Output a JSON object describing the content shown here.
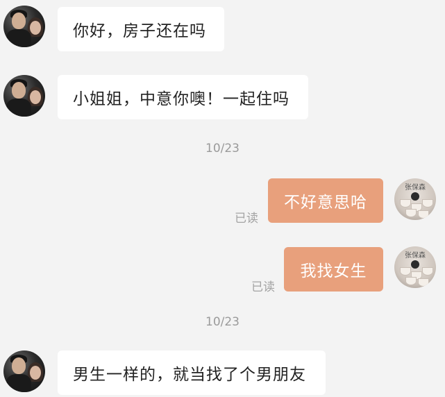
{
  "messages": [
    {
      "text": "你好，房子还在吗"
    },
    {
      "text": "小姐姐，中意你噢！一起住吗"
    },
    {
      "text": "不好意思哈",
      "status": "已读"
    },
    {
      "text": "我找女生",
      "status": "已读"
    },
    {
      "text": "男生一样的，就当找了个男朋友"
    }
  ],
  "timestamps": [
    "10/23",
    "10/23"
  ],
  "self_avatar": {
    "watermark": "张保森"
  },
  "colors": {
    "background": "#f3f3f3",
    "incoming_bubble": "#ffffff",
    "outgoing_bubble": "#e8a07c",
    "read_status": "#a3a3a3",
    "timestamp": "#9a9a9a"
  }
}
